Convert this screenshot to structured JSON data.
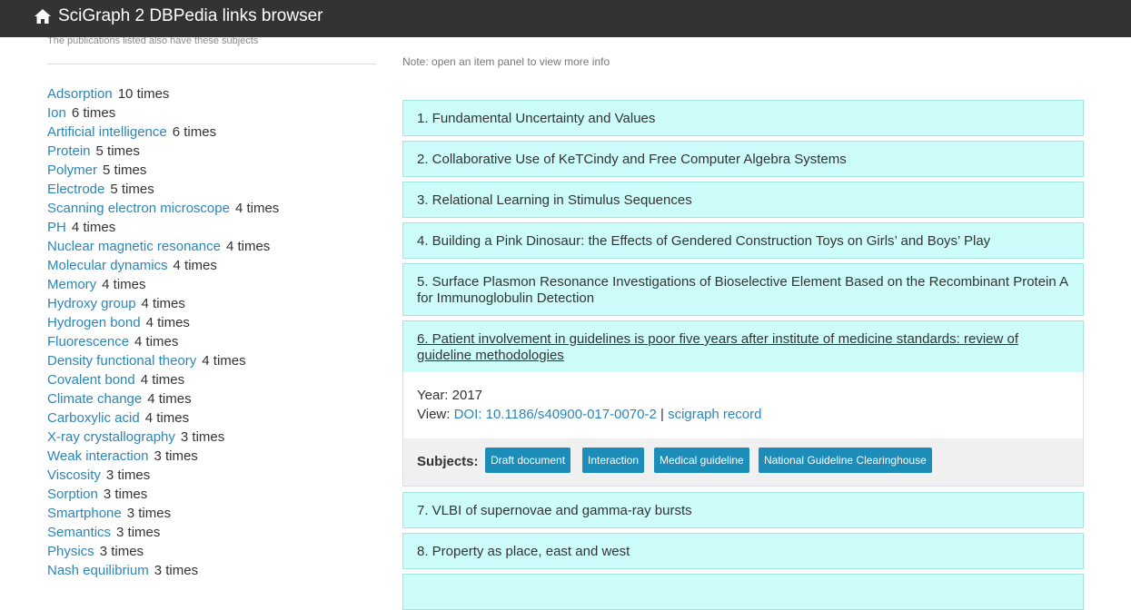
{
  "header": {
    "home_icon": "home-icon",
    "title": "SciGraph 2 DBPedia links browser"
  },
  "sidebar": {
    "subtitle": "The publications listed also have these subjects",
    "subjects": [
      {
        "name": "Adsorption",
        "count": "10 times"
      },
      {
        "name": "Ion",
        "count": "6 times"
      },
      {
        "name": "Artificial intelligence",
        "count": "6 times"
      },
      {
        "name": "Protein",
        "count": "5 times"
      },
      {
        "name": "Polymer",
        "count": "5 times"
      },
      {
        "name": "Electrode",
        "count": "5 times"
      },
      {
        "name": "Scanning electron microscope",
        "count": "4 times"
      },
      {
        "name": "PH",
        "count": "4 times"
      },
      {
        "name": "Nuclear magnetic resonance",
        "count": "4 times"
      },
      {
        "name": "Molecular dynamics",
        "count": "4 times"
      },
      {
        "name": "Memory",
        "count": "4 times"
      },
      {
        "name": "Hydroxy group",
        "count": "4 times"
      },
      {
        "name": "Hydrogen bond",
        "count": "4 times"
      },
      {
        "name": "Fluorescence",
        "count": "4 times"
      },
      {
        "name": "Density functional theory",
        "count": "4 times"
      },
      {
        "name": "Covalent bond",
        "count": "4 times"
      },
      {
        "name": "Climate change",
        "count": "4 times"
      },
      {
        "name": "Carboxylic acid",
        "count": "4 times"
      },
      {
        "name": "X-ray crystallography",
        "count": "3 times"
      },
      {
        "name": "Weak interaction",
        "count": "3 times"
      },
      {
        "name": "Viscosity",
        "count": "3 times"
      },
      {
        "name": "Sorption",
        "count": "3 times"
      },
      {
        "name": "Smartphone",
        "count": "3 times"
      },
      {
        "name": "Semantics",
        "count": "3 times"
      },
      {
        "name": "Physics",
        "count": "3 times"
      },
      {
        "name": "Nash equilibrium",
        "count": "3 times"
      }
    ]
  },
  "main": {
    "note": "Note: open an item panel to view more info",
    "items": [
      {
        "title": "1. Fundamental Uncertainty and Values"
      },
      {
        "title": "2. Collaborative Use of KeTCindy and Free Computer Algebra Systems"
      },
      {
        "title": "3. Relational Learning in Stimulus Sequences"
      },
      {
        "title": "4. Building a Pink Dinosaur: the Effects of Gendered Construction Toys on Girls’ and Boys’ Play"
      },
      {
        "title": "5. Surface Plasmon Resonance Investigations of Bioselective Element Based on the Recombinant Protein A for Immunoglobulin Detection"
      },
      {
        "title": "6. Patient involvement in guidelines is poor five years after institute of medicine standards: review of guideline methodologies"
      },
      {
        "title": "7. VLBI of supernovae and gamma-ray bursts"
      },
      {
        "title": "8. Property as place, east and west"
      }
    ],
    "open_item": {
      "year": "Year: 2017",
      "view_label": "View:",
      "doi_link": "DOI: 10.1186/s40900-017-0070-2",
      "separator": "|",
      "scigraph_link": "scigraph record",
      "subjects_label": "Subjects:",
      "tags": [
        "Draft document",
        "Interaction",
        "Medical guideline",
        "National Guideline Clearinghouse"
      ]
    }
  }
}
